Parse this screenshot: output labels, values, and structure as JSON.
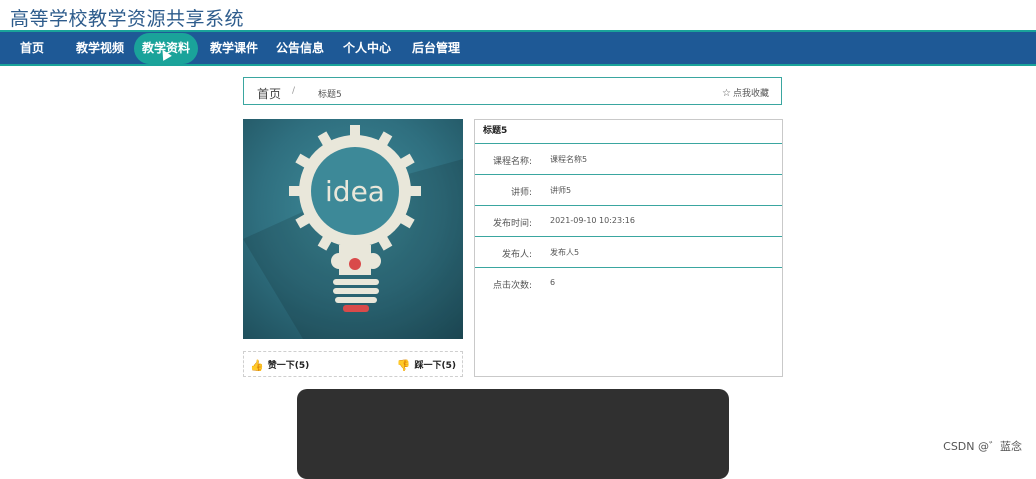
{
  "site": {
    "title": "高等学校教学资源共享系统"
  },
  "nav": {
    "items": [
      {
        "label": "首页"
      },
      {
        "label": "教学视频"
      },
      {
        "label": "教学资料"
      },
      {
        "label": "教学课件"
      },
      {
        "label": "公告信息"
      },
      {
        "label": "个人中心"
      },
      {
        "label": "后台管理"
      }
    ],
    "active_index": 2
  },
  "breadcrumb": {
    "home": "首页",
    "separator": "/",
    "current": "标题5",
    "favorite": "点我收藏"
  },
  "cover": {
    "alt_text": "idea"
  },
  "vote": {
    "up": "赞一下(5)",
    "down": "踩一下(5)"
  },
  "detail": {
    "title": "标题5",
    "rows": [
      {
        "label": "课程名称:",
        "value": "课程名称5"
      },
      {
        "label": "讲师:",
        "value": "讲师5"
      },
      {
        "label": "发布时间:",
        "value": "2021-09-10 10:23:16"
      },
      {
        "label": "发布人:",
        "value": "发布人5"
      },
      {
        "label": "点击次数:",
        "value": "6"
      }
    ]
  },
  "watermark": "CSDN @゛蓝念",
  "colors": {
    "nav_bg": "#1e5996",
    "accent": "#1aa39a",
    "title": "#2e5c8c"
  }
}
